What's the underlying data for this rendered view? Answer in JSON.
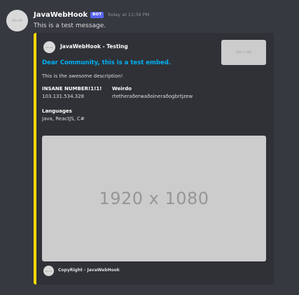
{
  "message": {
    "avatar_text": "96×96",
    "author": "JavaWebHook",
    "badge": "BOT",
    "timestamp": "Today at 11:39 PM",
    "content": "This is a test message."
  },
  "embed": {
    "accent_color": "#ffd700",
    "author_icon_text": "96×96",
    "author_name": "JavaWebHook - Testing",
    "thumbnail_text": "100 x 100",
    "title": "Dear Community, this is a test embed.",
    "description": "This is the awesome description!",
    "fields": [
      {
        "name": "INSANE NUMBER!1!1!",
        "value": "103.131.534.328"
      },
      {
        "name": "Weirdo",
        "value": "rtetheraðerwaðoineraðogbrtjzew"
      },
      {
        "name": "Languages",
        "value": "Java, ReactJS, C#"
      }
    ],
    "image_text": "1920 x 1080",
    "footer_icon_text": "96×96",
    "footer_text": "CopyRight - JavaWebHook"
  }
}
